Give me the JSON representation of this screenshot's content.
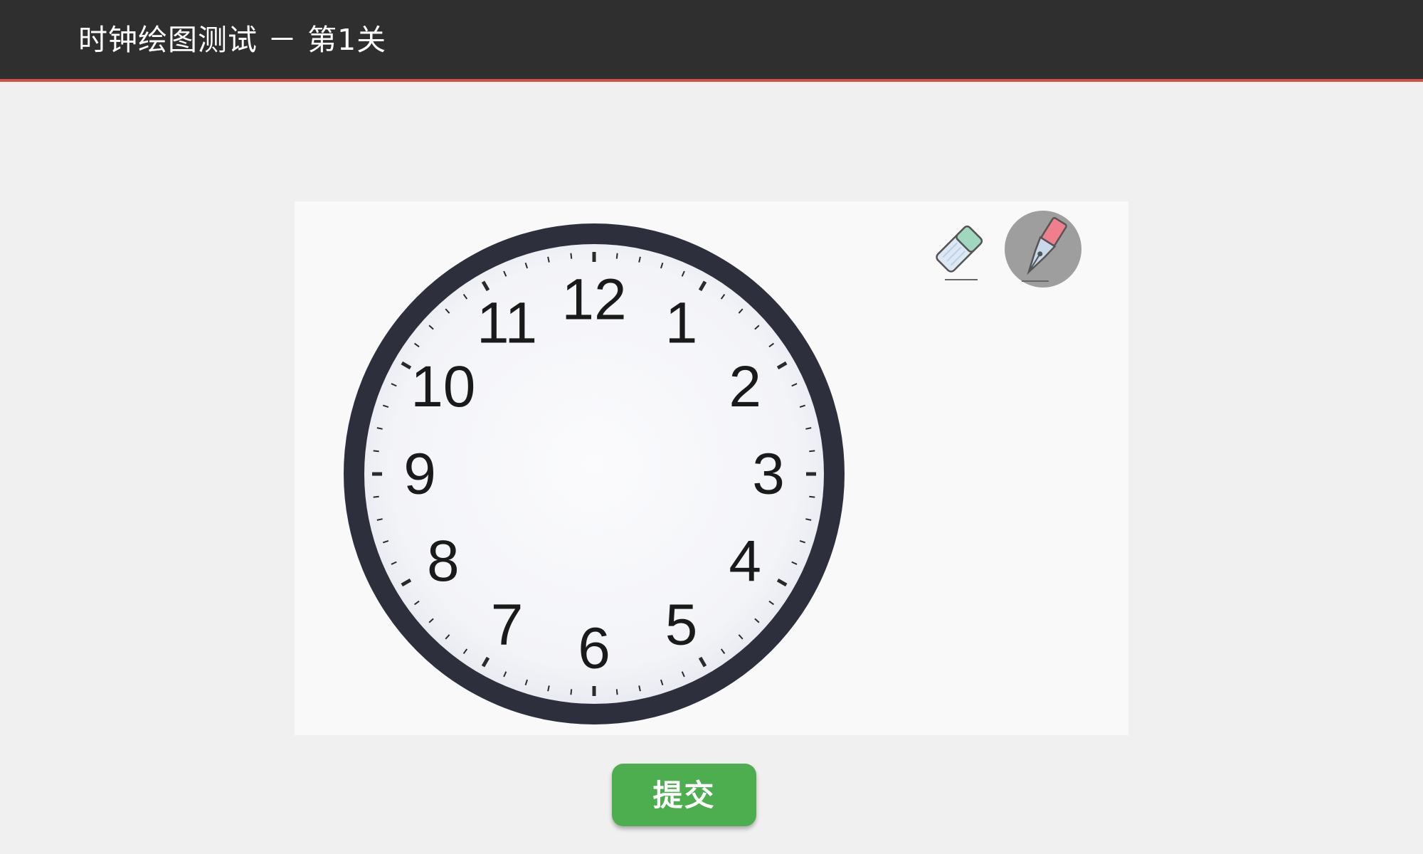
{
  "header": {
    "title": "时钟绘图测试 － 第1关"
  },
  "clock": {
    "numerals": [
      "12",
      "1",
      "2",
      "3",
      "4",
      "5",
      "6",
      "7",
      "8",
      "9",
      "10",
      "11"
    ]
  },
  "toolbar": {
    "tools": [
      {
        "icon": "eraser-icon"
      },
      {
        "icon": "pen-icon",
        "active": true
      }
    ]
  },
  "actions": {
    "submit_label": "提交"
  },
  "colors": {
    "header_bg": "#2f2f2f",
    "header_accent": "#d9503f",
    "submit_green": "#4cae4f",
    "clock_rim": "#2d2f3d",
    "active_tool_bg": "#9e9e9e"
  }
}
